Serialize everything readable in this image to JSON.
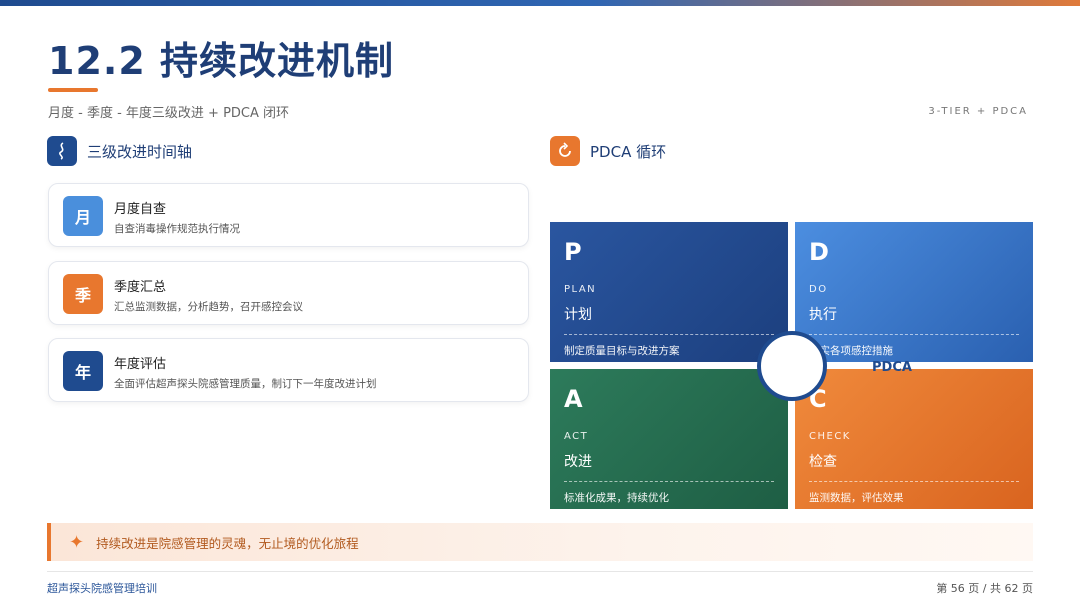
{
  "header": {
    "title": "12.2 持续改进机制",
    "subtitle": "月度 - 季度 - 年度三级改进 + PDCA 闭环",
    "tag": "3-TIER + PDCA"
  },
  "left": {
    "section_title": "三级改进时间轴",
    "icon": "timeline-icon",
    "tiers": [
      {
        "badge": "月",
        "name": "月度自查",
        "desc": "自查消毒操作规范执行情况",
        "color": "#4a8fdc"
      },
      {
        "badge": "季",
        "name": "季度汇总",
        "desc": "汇总监测数据，分析趋势，召开感控会议",
        "color": "#e8772e"
      },
      {
        "badge": "年",
        "name": "年度评估",
        "desc": "全面评估超声探头院感管理质量，制订下一年度改进计划",
        "color": "#1f4b8f"
      }
    ]
  },
  "right": {
    "section_title": "PDCA 循环",
    "icon": "cycle-icon",
    "center_label": "PDCA",
    "quadrants": [
      {
        "letter": "P",
        "en": "PLAN",
        "cn": "计划",
        "desc": "制定质量目标与改进方案",
        "color": "#214a8c"
      },
      {
        "letter": "D",
        "en": "DO",
        "cn": "执行",
        "desc": "落实各项感控措施",
        "color": "#3a78cc"
      },
      {
        "letter": "A",
        "en": "ACT",
        "cn": "改进",
        "desc": "标准化成果，持续优化",
        "color": "#226a4e"
      },
      {
        "letter": "C",
        "en": "CHECK",
        "cn": "检查",
        "desc": "监测数据，评估效果",
        "color": "#e07028"
      }
    ]
  },
  "banner": {
    "icon": "sparkle-icon",
    "text": "持续改进是院感管理的灵魂，无止境的优化旅程"
  },
  "footer": {
    "left": "超声探头院感管理培训",
    "right": "第 56 页 / 共 62 页"
  }
}
